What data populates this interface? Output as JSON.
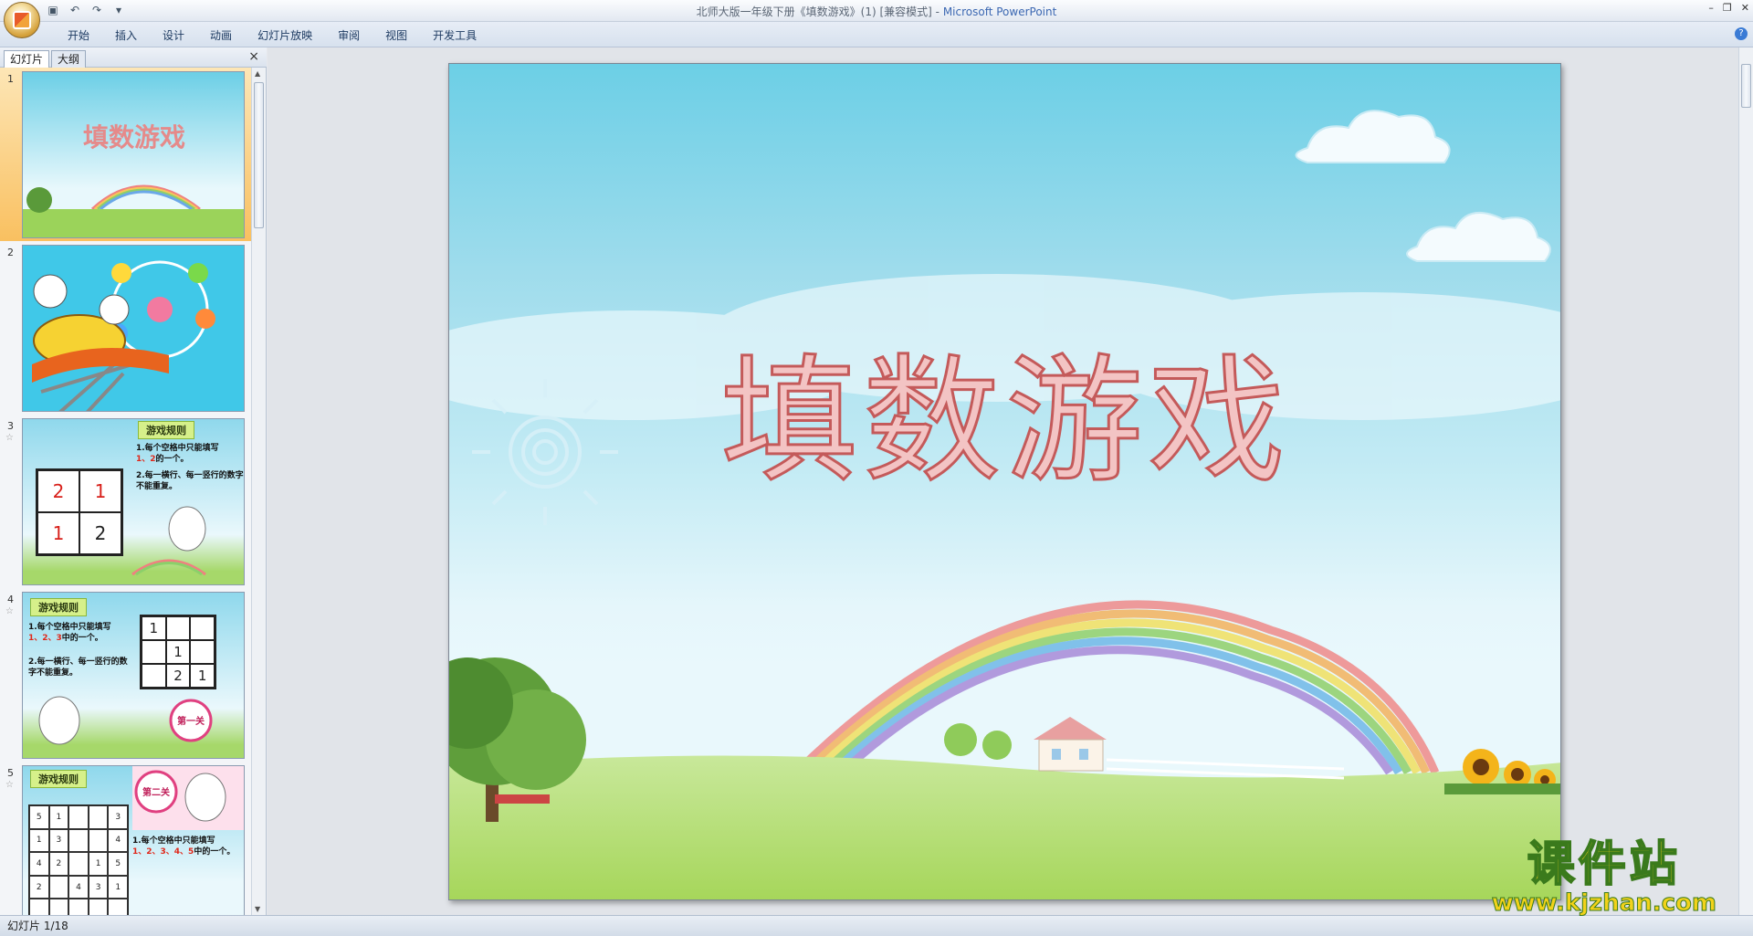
{
  "window": {
    "title_doc": "北师大版一年级下册《填数游戏》(1) [兼容模式]",
    "title_sep": " - ",
    "title_app": "Microsoft PowerPoint"
  },
  "ribbon": {
    "tabs": [
      "开始",
      "插入",
      "设计",
      "动画",
      "幻灯片放映",
      "审阅",
      "视图",
      "开发工具"
    ]
  },
  "pane": {
    "tab_slides": "幻灯片",
    "tab_outline": "大纲",
    "close": "×"
  },
  "thumbnails": [
    {
      "num": "1",
      "title": "填数游戏"
    },
    {
      "num": "2"
    },
    {
      "num": "3",
      "badge": "游戏规则",
      "grid": [
        "2",
        "1",
        "1",
        "2"
      ],
      "rule1a": "1.每个空格中只能填写",
      "rule1b": "1、2",
      "rule1c": "的一个。",
      "rule2": "2.每一横行、每一竖行的数字不能重复。"
    },
    {
      "num": "4",
      "badge": "游戏规则",
      "grid": [
        "1",
        "",
        "",
        "",
        "1",
        "",
        "",
        "2",
        "1"
      ],
      "rule1a": "1.每个空格中只能填写",
      "rule1b": "1、2、3",
      "rule1c": "中的一个。",
      "rule2": "2.每一横行、每一竖行的数字不能重复。",
      "level": "第一关"
    },
    {
      "num": "5",
      "badge": "游戏规则",
      "grid": [
        "5",
        "1",
        "",
        "",
        "3",
        "1",
        "3",
        "",
        "",
        "4",
        "4",
        "2",
        "",
        "1",
        "5",
        "2",
        "",
        "4",
        "3",
        "1",
        "",
        "",
        "",
        "",
        ""
      ],
      "rule1a": "1.每个空格中只能填写",
      "rule1b": "1、2、3、4、5",
      "rule1c": "中的一个。",
      "level": "第二关"
    }
  ],
  "slide": {
    "title": "填数游戏"
  },
  "watermark": {
    "main": "课件站",
    "url": "www.kjzhan.com"
  },
  "status": {
    "slide_indicator": "幻灯片 1/18"
  },
  "colors": {
    "title_fill": "#f3c4c4",
    "title_stroke": "#c45a5a",
    "selected_thumb": "#f9c060"
  }
}
